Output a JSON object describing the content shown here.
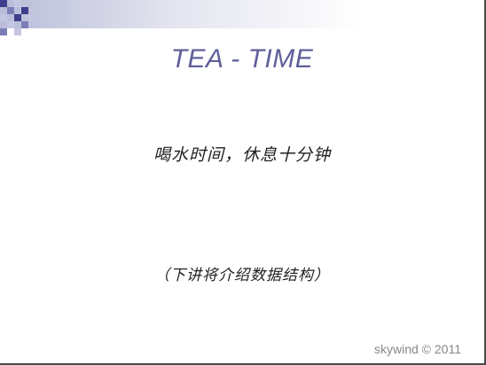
{
  "slide": {
    "title": "TEA - TIME",
    "subtitle": "喝水时间，休息十分钟",
    "note": "（下讲将介绍数据结构）",
    "watermark": "skywind © 2011"
  },
  "colors": {
    "title": "#5f5f9a",
    "decoration_dark": "#3d3f8c",
    "decoration_mid": "#7b7fb8",
    "decoration_light": "#c5c7e2",
    "band": "#b9bcd8"
  }
}
